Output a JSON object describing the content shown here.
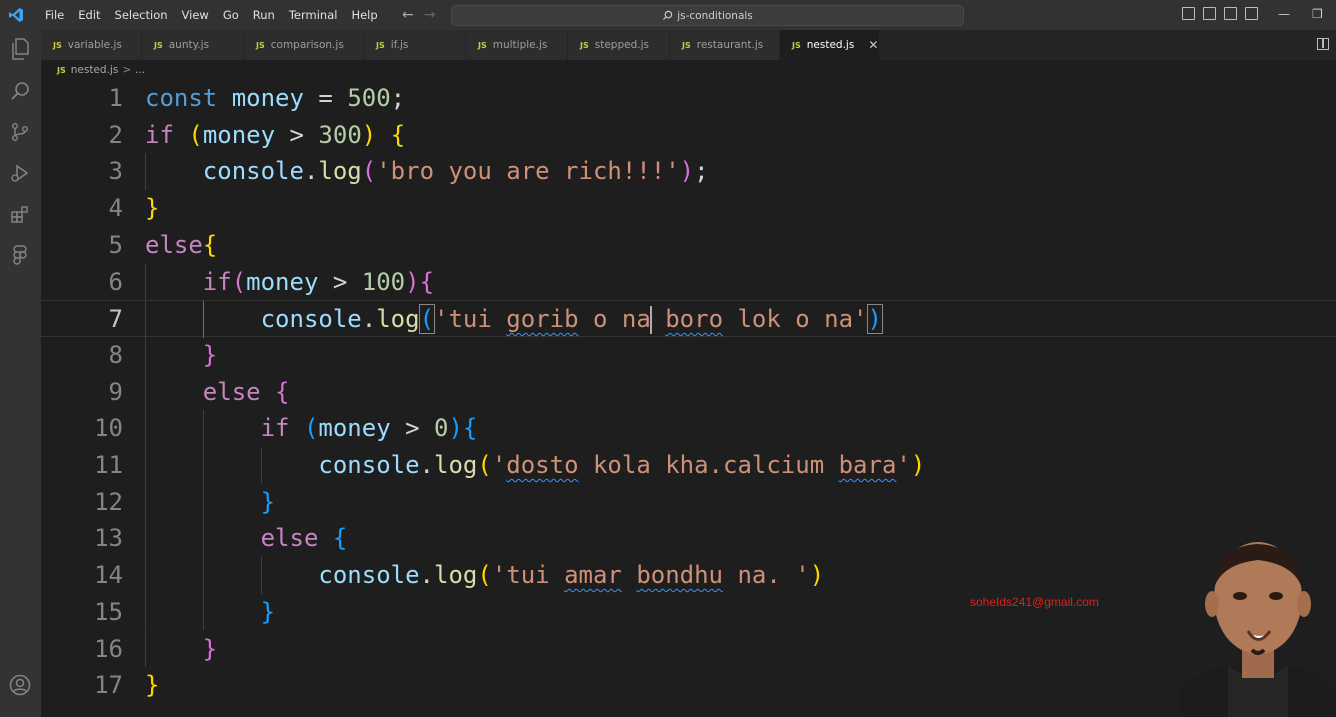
{
  "menu": [
    "File",
    "Edit",
    "Selection",
    "View",
    "Go",
    "Run",
    "Terminal",
    "Help"
  ],
  "search": {
    "label": "js-conditionals"
  },
  "tabs": [
    {
      "label": "variable.js",
      "active": false,
      "w": 101
    },
    {
      "label": "aunty.js",
      "active": false,
      "w": 102
    },
    {
      "label": "comparison.js",
      "active": false,
      "w": 120
    },
    {
      "label": "if.js",
      "active": false,
      "w": 102
    },
    {
      "label": "multiple.js",
      "active": false,
      "w": 102
    },
    {
      "label": "stepped.js",
      "active": false,
      "w": 102
    },
    {
      "label": "restaurant.js",
      "active": false,
      "w": 110
    },
    {
      "label": "nested.js",
      "active": true,
      "w": 100
    }
  ],
  "tab_badge": "JS",
  "breadcrumb": {
    "file": "nested.js",
    "sep": ">",
    "rest": "..."
  },
  "editor": {
    "current_line": 7,
    "lines": [
      {
        "n": "1",
        "indent": 0,
        "tokens": [
          [
            "kw",
            "const"
          ],
          [
            "",
            ""
          ],
          [
            "op",
            " "
          ],
          [
            "var",
            "money"
          ],
          [
            "op",
            " = "
          ],
          [
            "num",
            "500"
          ],
          [
            "op",
            ";"
          ]
        ]
      },
      {
        "n": "2",
        "indent": 0,
        "tokens": [
          [
            "ctl",
            "if"
          ],
          [
            "op",
            " "
          ],
          [
            "b1",
            "("
          ],
          [
            "var",
            "money"
          ],
          [
            "op",
            " > "
          ],
          [
            "num",
            "300"
          ],
          [
            "b1",
            ")"
          ],
          [
            "op",
            " "
          ],
          [
            "b1",
            "{"
          ]
        ]
      },
      {
        "n": "3",
        "indent": 1,
        "tokens": [
          [
            "var",
            "console"
          ],
          [
            "op",
            "."
          ],
          [
            "fn",
            "log"
          ],
          [
            "b2",
            "("
          ],
          [
            "str",
            "'bro you are rich!!!'"
          ],
          [
            "b2",
            ")"
          ],
          [
            "op",
            ";"
          ]
        ]
      },
      {
        "n": "4",
        "indent": 0,
        "tokens": [
          [
            "b1",
            "}"
          ]
        ]
      },
      {
        "n": "5",
        "indent": 0,
        "tokens": [
          [
            "ctl",
            "else"
          ],
          [
            "b1",
            "{"
          ]
        ]
      },
      {
        "n": "6",
        "indent": 1,
        "tokens": [
          [
            "ctl",
            "if"
          ],
          [
            "b2",
            "("
          ],
          [
            "var",
            "money"
          ],
          [
            "op",
            " > "
          ],
          [
            "num",
            "100"
          ],
          [
            "b2",
            ")"
          ],
          [
            "b2",
            "{"
          ]
        ]
      },
      {
        "n": "7",
        "indent": 2,
        "tokens": [
          [
            "var",
            "console"
          ],
          [
            "op",
            "."
          ],
          [
            "fn",
            "log"
          ],
          [
            "b3m",
            "("
          ],
          [
            "str",
            "'tui "
          ],
          [
            "strsq",
            "gorib"
          ],
          [
            "str",
            " o na"
          ],
          [
            "caret",
            ""
          ],
          [
            "str",
            " "
          ],
          [
            "strsq",
            "boro"
          ],
          [
            "str",
            " lok o na'"
          ],
          [
            "b3m",
            ")"
          ]
        ]
      },
      {
        "n": "8",
        "indent": 1,
        "tokens": [
          [
            "b2",
            "}"
          ]
        ]
      },
      {
        "n": "9",
        "indent": 1,
        "tokens": [
          [
            "ctl",
            "else"
          ],
          [
            "op",
            " "
          ],
          [
            "b2",
            "{"
          ]
        ]
      },
      {
        "n": "10",
        "indent": 2,
        "tokens": [
          [
            "ctl",
            "if"
          ],
          [
            "op",
            " "
          ],
          [
            "b3",
            "("
          ],
          [
            "var",
            "money"
          ],
          [
            "op",
            " > "
          ],
          [
            "num",
            "0"
          ],
          [
            "b3",
            ")"
          ],
          [
            "b3",
            "{"
          ]
        ]
      },
      {
        "n": "11",
        "indent": 3,
        "tokens": [
          [
            "var",
            "console"
          ],
          [
            "op",
            "."
          ],
          [
            "fn",
            "log"
          ],
          [
            "b1",
            "("
          ],
          [
            "str",
            "'"
          ],
          [
            "strsq",
            "dosto"
          ],
          [
            "str",
            " kola kha.calcium "
          ],
          [
            "strsq",
            "bara"
          ],
          [
            "str",
            "'"
          ],
          [
            "b1",
            ")"
          ]
        ]
      },
      {
        "n": "12",
        "indent": 2,
        "tokens": [
          [
            "b3",
            "}"
          ]
        ]
      },
      {
        "n": "13",
        "indent": 2,
        "tokens": [
          [
            "ctl",
            "else"
          ],
          [
            "op",
            " "
          ],
          [
            "b3",
            "{"
          ]
        ]
      },
      {
        "n": "14",
        "indent": 3,
        "tokens": [
          [
            "var",
            "console"
          ],
          [
            "op",
            "."
          ],
          [
            "fn",
            "log"
          ],
          [
            "b1",
            "("
          ],
          [
            "str",
            "'tui "
          ],
          [
            "strsq",
            "amar"
          ],
          [
            "str",
            " "
          ],
          [
            "strsq",
            "bondhu"
          ],
          [
            "str",
            " na. '"
          ],
          [
            "b1",
            ")"
          ]
        ]
      },
      {
        "n": "15",
        "indent": 2,
        "tokens": [
          [
            "b3",
            "}"
          ]
        ]
      },
      {
        "n": "16",
        "indent": 1,
        "tokens": [
          [
            "b2",
            "}"
          ]
        ]
      },
      {
        "n": "17",
        "indent": 0,
        "tokens": [
          [
            "b1",
            "}"
          ]
        ]
      }
    ]
  },
  "overlay": {
    "email": "soheIds241@gmail.com"
  },
  "colors": {
    "keyword": "#569cd6",
    "control": "#c586c0",
    "variable": "#9cdcfe",
    "number": "#b5cea8",
    "string": "#ce9178",
    "function": "#dcdcaa"
  }
}
